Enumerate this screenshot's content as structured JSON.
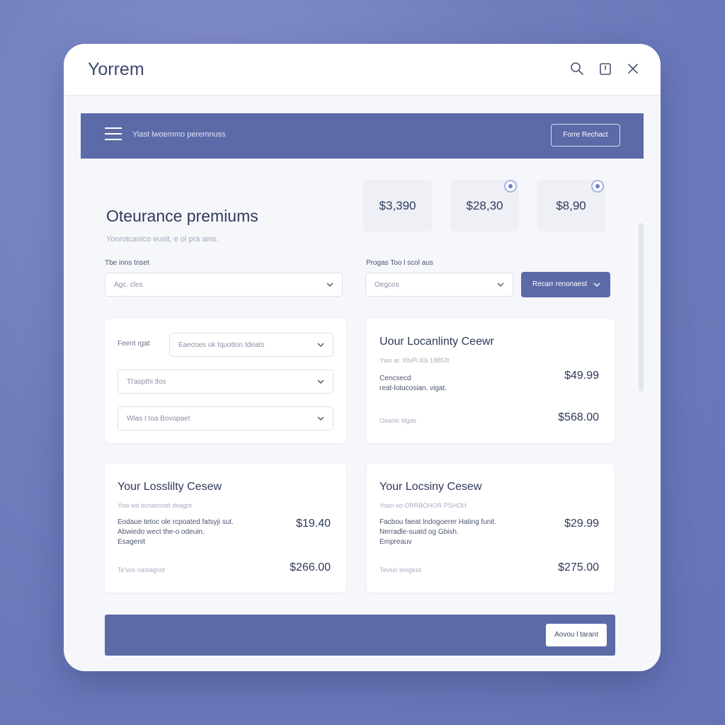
{
  "app": {
    "title": "Yorrem",
    "icons": [
      "search-icon",
      "save-icon",
      "close-icon"
    ]
  },
  "banner": {
    "text": "Yiast lwoemmo peremnuss",
    "button_label": "Forre Rechact"
  },
  "page": {
    "title": "Oteurance premiums",
    "subtitle": "Yonrotcanico eusit, e ol pra ains."
  },
  "stats": [
    {
      "value": "$3,390"
    },
    {
      "value": "$28,30"
    },
    {
      "value": "$8,90"
    }
  ],
  "filters": {
    "left": {
      "label": "Tbe inns tnset",
      "value": "Agc. cles"
    },
    "right": {
      "label": "Progas Too l scol aus",
      "value": "Oegcos"
    },
    "action_label": "Recarr renonaest"
  },
  "filter_card": {
    "label": "Feent rgat",
    "selects": [
      "Eaecoes ok tquotton tdeats",
      "Tl'aspthi tlos",
      "Wlas t toa Bovopaet"
    ]
  },
  "plans": [
    {
      "title": "Uour Locanlinty Ceewr",
      "subtitle": "Ywo ar.  l0lvPi 83i 18853t",
      "desc": [
        "Cencsecd",
        "reat-lotucosian, vigat."
      ],
      "price": "$49.99",
      "footer": "Oeanic tiigas",
      "total": "$568.00"
    },
    {
      "title": "Your Losslilty Cesew",
      "subtitle": "Yow wd ecnaesnet deagot",
      "desc": [
        "Eodaue tetoc ole rcpoated fatsyji sut.",
        "Abwiedo wect the-o odeuin.",
        "Esagenit"
      ],
      "price": "$19.40",
      "footer": "Te'vos nastagnst",
      "total": "$266.00"
    },
    {
      "title": "Your Locsiny Cesew",
      "subtitle": "Yoan oo ORRBOHOR PSHOH",
      "desc": [
        "Facbou faeat lndogoerer Hating funit.",
        "Nerradle-suatd og Gbish.",
        "Empreauv"
      ],
      "price": "$29.99",
      "footer": "Tevsio teegess",
      "total": "$275.00"
    }
  ],
  "footer": {
    "button_label": "Aovou l tarant"
  },
  "colors": {
    "background": "#6f7dbd",
    "accent": "#5c6aa8",
    "window": "#f6f7fb",
    "text": "#2f3a5b"
  }
}
